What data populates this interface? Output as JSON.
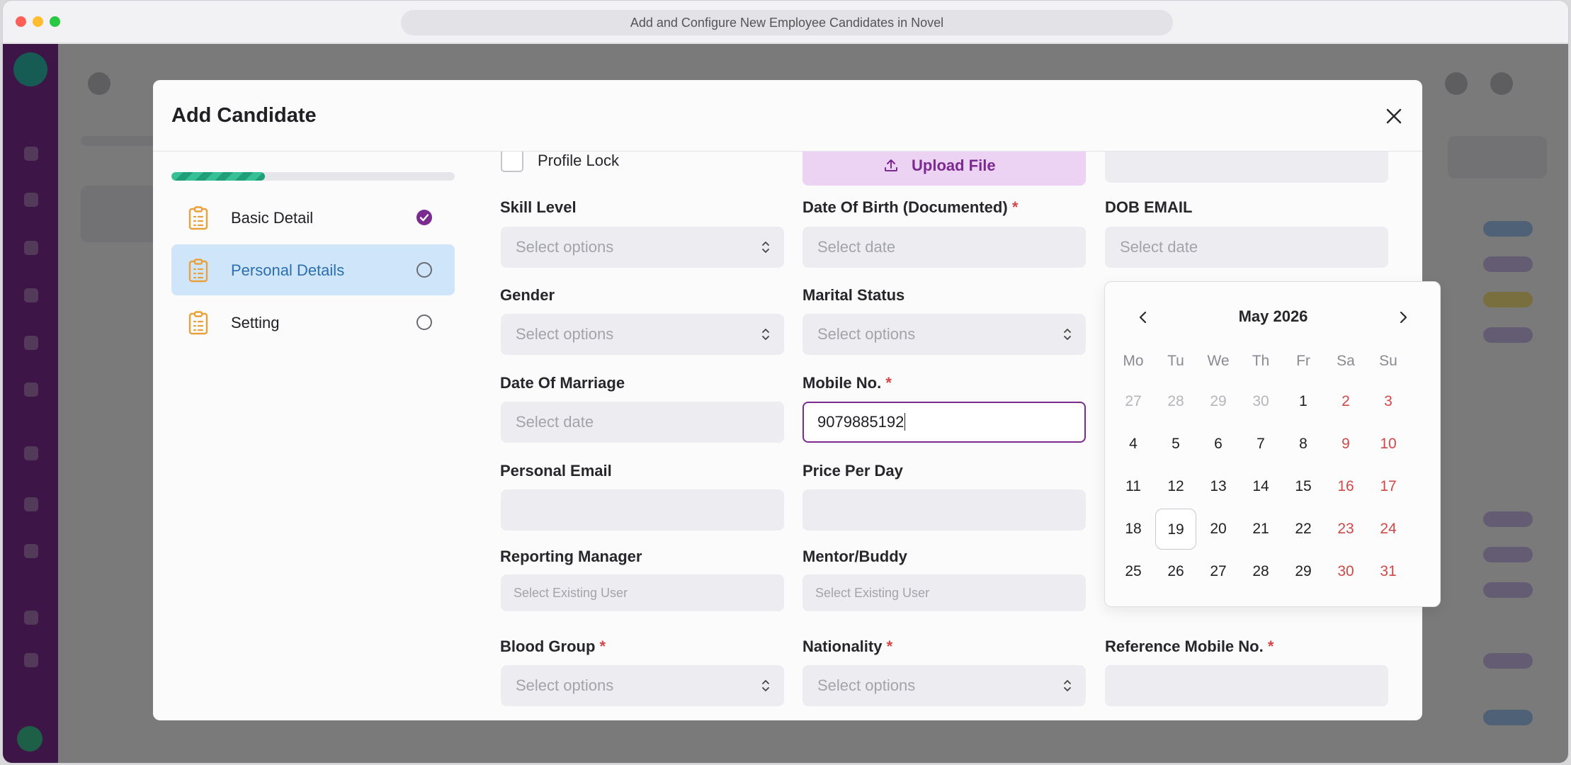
{
  "window": {
    "url_title": "Add and Configure New Employee Candidates in Novel"
  },
  "modal": {
    "title": "Add Candidate",
    "progress_fraction": 0.33,
    "steps": [
      {
        "label": "Basic Detail",
        "state": "done"
      },
      {
        "label": "Personal Details",
        "state": "active"
      },
      {
        "label": "Setting",
        "state": "pending"
      }
    ]
  },
  "form": {
    "profile_lock_label": "Profile Lock",
    "upload_label": "Upload File",
    "skill_level": {
      "label": "Skill Level",
      "placeholder": "Select options"
    },
    "dob_documented": {
      "label": "Date Of Birth (Documented)",
      "required": "*",
      "placeholder": "Select date"
    },
    "dob_email": {
      "label": "DOB EMAIL",
      "placeholder": "Select date"
    },
    "gender": {
      "label": "Gender",
      "placeholder": "Select options"
    },
    "marital_status": {
      "label": "Marital Status",
      "placeholder": "Select options"
    },
    "date_of_marriage": {
      "label": "Date Of Marriage",
      "placeholder": "Select date"
    },
    "mobile_no": {
      "label": "Mobile No.",
      "required": "*",
      "value": "9079885192"
    },
    "personal_email": {
      "label": "Personal Email",
      "value": ""
    },
    "price_per_day": {
      "label": "Price Per Day",
      "value": ""
    },
    "reporting_manager": {
      "label": "Reporting Manager",
      "placeholder": "Select Existing User"
    },
    "mentor_buddy": {
      "label": "Mentor/Buddy",
      "placeholder": "Select Existing User"
    },
    "blood_group": {
      "label": "Blood Group",
      "required": "*",
      "placeholder": "Select options"
    },
    "nationality": {
      "label": "Nationality",
      "required": "*",
      "placeholder": "Select options"
    },
    "reference_mobile": {
      "label": "Reference Mobile No.",
      "required": "*",
      "value": ""
    }
  },
  "calendar": {
    "month_label": "May 2026",
    "weekdays": [
      "Mo",
      "Tu",
      "We",
      "Th",
      "Fr",
      "Sa",
      "Su"
    ],
    "weeks": [
      [
        "27",
        "28",
        "29",
        "30",
        "1",
        "2",
        "3"
      ],
      [
        "4",
        "5",
        "6",
        "7",
        "8",
        "9",
        "10"
      ],
      [
        "11",
        "12",
        "13",
        "14",
        "15",
        "16",
        "17"
      ],
      [
        "18",
        "19",
        "20",
        "21",
        "22",
        "23",
        "24"
      ],
      [
        "25",
        "26",
        "27",
        "28",
        "29",
        "30",
        "31"
      ]
    ],
    "outside_month_cells": [
      "0-0",
      "0-1",
      "0-2",
      "0-3"
    ],
    "today": "19"
  },
  "colors": {
    "brand": "#7b2a8f",
    "progress": "#1f9e78",
    "active_step_bg": "#cfe5f9",
    "weekend": "#d04848",
    "required": "#d64545"
  }
}
